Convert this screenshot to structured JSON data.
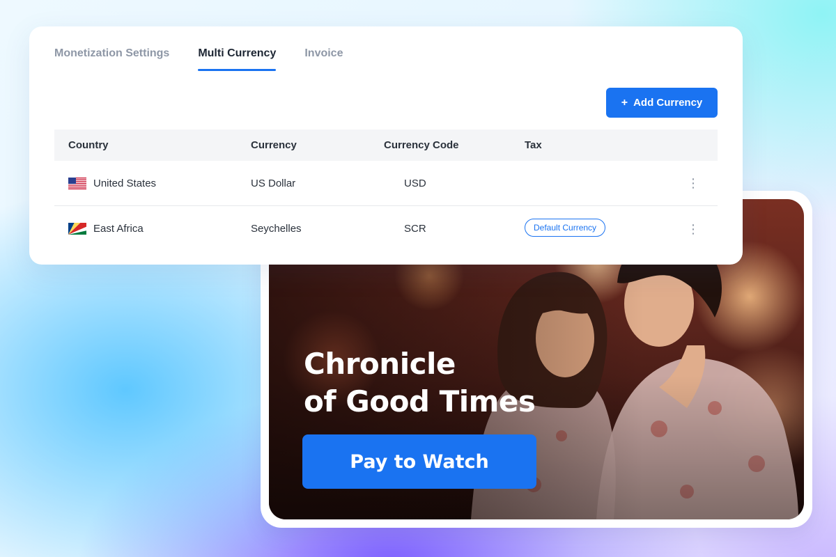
{
  "tabs": [
    {
      "label": "Monetization Settings",
      "active": false
    },
    {
      "label": "Multi Currency",
      "active": true
    },
    {
      "label": "Invoice",
      "active": false
    }
  ],
  "add_currency_button": {
    "icon": "plus-icon",
    "label": "Add Currency"
  },
  "table": {
    "headers": [
      "Country",
      "Currency",
      "Currency Code",
      "Tax"
    ],
    "rows": [
      {
        "flag_icon": "us-flag-icon",
        "country": "United States",
        "currency": "US Dollar",
        "code": "USD",
        "tax": "",
        "menu_icon": "kebab-menu-icon"
      },
      {
        "flag_icon": "seychelles-flag-icon",
        "country": "East Africa",
        "currency": "Seychelles",
        "code": "SCR",
        "tax": "Default Currency",
        "menu_icon": "kebab-menu-icon"
      }
    ]
  },
  "video": {
    "title_line1": "Chronicle",
    "title_line2": "of Good Times",
    "pay_button": "Pay to Watch"
  },
  "colors": {
    "accent": "#1a73f1",
    "tab_active_text": "#1d2633",
    "tab_inactive_text": "#8e97a6",
    "table_header_bg": "#f4f5f7"
  }
}
